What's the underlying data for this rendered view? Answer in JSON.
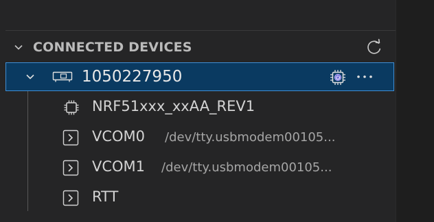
{
  "section": {
    "title": "CONNECTED DEVICES"
  },
  "device": {
    "id": "1050227950"
  },
  "children": [
    {
      "label": "NRF51xxx_xxAA_REV1",
      "path": ""
    },
    {
      "label": "VCOM0",
      "path": "/dev/tty.usbmodem00105..."
    },
    {
      "label": "VCOM1",
      "path": "/dev/tty.usbmodem00105..."
    },
    {
      "label": "RTT",
      "path": ""
    }
  ],
  "icons": {
    "section_toggle": "chevron-down-icon",
    "refresh": "refresh-icon",
    "device_toggle": "chevron-down-icon",
    "device": "device-board-icon",
    "chip_action": "chip-power-icon",
    "more": "more-icon",
    "chip": "chip-icon",
    "terminal": "terminal-chevron-icon"
  },
  "colors": {
    "background": "#252526",
    "selection": "#0a3a61",
    "selection_border": "#3f8fd6",
    "text": "#d4d4d4"
  }
}
